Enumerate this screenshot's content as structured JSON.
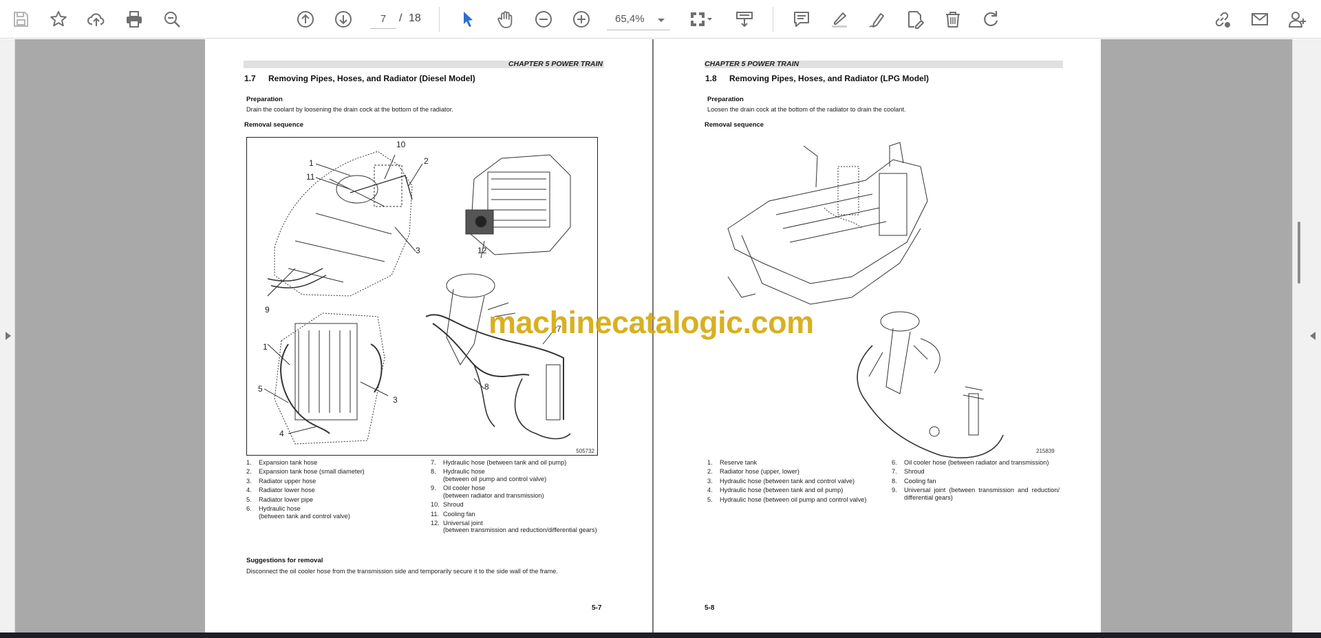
{
  "toolbar": {
    "current_page": "7",
    "total_pages": "18",
    "separator": "/",
    "zoom": "65,4%"
  },
  "left_page": {
    "chapter": "CHAPTER 5 POWER TRAIN",
    "section_number": "1.7",
    "section_title": "Removing Pipes, Hoses, and Radiator (Diesel Model)",
    "preparation_label": "Preparation",
    "preparation_text": "Drain the coolant by loosening the drain cock at the bottom of the radiator.",
    "removal_label": "Removal sequence",
    "figure_id": "505732",
    "callouts": [
      "10",
      "1",
      "2",
      "11",
      "3",
      "12",
      "9",
      "1",
      "5",
      "3",
      "4",
      "8",
      "7"
    ],
    "legend_col1": [
      {
        "num": "1.",
        "text": "Expansion tank hose"
      },
      {
        "num": "2.",
        "text": "Expansion tank hose (small diameter)"
      },
      {
        "num": "3.",
        "text": "Radiator upper hose"
      },
      {
        "num": "4.",
        "text": "Radiator lower hose"
      },
      {
        "num": "5.",
        "text": "Radiator lower pipe"
      },
      {
        "num": "6.",
        "text": "Hydraulic hose\n(between tank and control valve)"
      }
    ],
    "legend_col2": [
      {
        "num": "7.",
        "text": "Hydraulic hose (between tank and oil pump)"
      },
      {
        "num": "8.",
        "text": "Hydraulic hose\n(between oil pump and control valve)"
      },
      {
        "num": "9.",
        "text": "Oil cooler hose\n(between radiator and transmission)"
      },
      {
        "num": "10.",
        "text": "Shroud"
      },
      {
        "num": "11.",
        "text": "Cooling fan"
      },
      {
        "num": "12.",
        "text": "Universal joint\n(between transmission and reduction/differential gears)"
      }
    ],
    "suggestions_label": "Suggestions for removal",
    "suggestions_text": "Disconnect the oil cooler hose from the transmission side and temporarily secure it to the side wall of the frame.",
    "page_number": "5-7"
  },
  "right_page": {
    "chapter": "CHAPTER 5 POWER TRAIN",
    "section_number": "1.8",
    "section_title": "Removing Pipes, Hoses, and Radiator (LPG Model)",
    "preparation_label": "Preparation",
    "preparation_text": "Loosen the drain cock at the bottom of the radiator to drain the coolant.",
    "removal_label": "Removal sequence",
    "figure_id": "215839",
    "legend_col1": [
      {
        "num": "1.",
        "text": "Reserve tank"
      },
      {
        "num": "2.",
        "text": "Radiator hose (upper, lower)"
      },
      {
        "num": "3.",
        "text": "Hydraulic hose (between tank and control valve)"
      },
      {
        "num": "4.",
        "text": "Hydraulic hose (between tank and oil pump)"
      },
      {
        "num": "5.",
        "text": "Hydraulic hose (between oil pump and control valve)"
      }
    ],
    "legend_col2": [
      {
        "num": "6.",
        "text": "Oil cooler hose (between radiator and transmission)"
      },
      {
        "num": "7.",
        "text": "Shroud"
      },
      {
        "num": "8.",
        "text": "Cooling fan"
      },
      {
        "num": "9.",
        "text": "Universal joint (between transmission and reduction/ differential gears)"
      }
    ],
    "page_number": "5-8"
  },
  "watermark": "machinecatalogic.com",
  "colors": {
    "toolbar_bg": "#ffffff",
    "icon_gray": "#6f6f6f",
    "icon_blue": "#2d6fd1",
    "viewer_gray": "#a9a9a9",
    "watermark": "#d4a80a"
  }
}
